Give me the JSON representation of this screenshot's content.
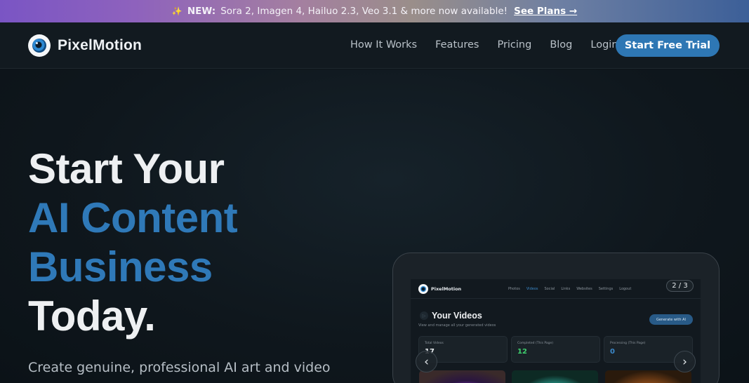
{
  "announcement": {
    "icon": "sparkle-icon",
    "badge": "NEW:",
    "text": "Sora 2, Imagen 4, Hailuo 2.3, Veo 3.1 & more now available!",
    "link": "See Plans →"
  },
  "nav": {
    "brand": "PixelMotion",
    "links": [
      "How It Works",
      "Features",
      "Pricing",
      "Blog",
      "Login"
    ],
    "cta": "Start Free Trial"
  },
  "hero": {
    "title_line1": "Start Your",
    "title_line2": "AI Content",
    "title_line3": "Business",
    "title_line4": "Today.",
    "subtitle": "Create genuine, professional AI art and video"
  },
  "carousel": {
    "page_indicator": "2 / 3",
    "prev": "‹",
    "next": "›"
  },
  "mockup": {
    "brand": "PixelMotion",
    "nav_links": [
      "Photos",
      "Videos",
      "Social",
      "Links",
      "Websites",
      "Settings",
      "Logout"
    ],
    "active_link": "Videos",
    "title": "Your Videos",
    "description": "View and manage all your generated videos",
    "generate_button": "Generate with AI",
    "stats": [
      {
        "label": "Total Videos",
        "value": "17",
        "color": "#e8ecef"
      },
      {
        "label": "Completed (This Page)",
        "value": "12",
        "color": "#3ecf6e"
      },
      {
        "label": "Processing (This Page)",
        "value": "0",
        "color": "#3b88c9"
      }
    ]
  },
  "colors": {
    "accent": "#2e77b4",
    "hero_blue": "#2f79b8",
    "background": "#0d1419"
  }
}
